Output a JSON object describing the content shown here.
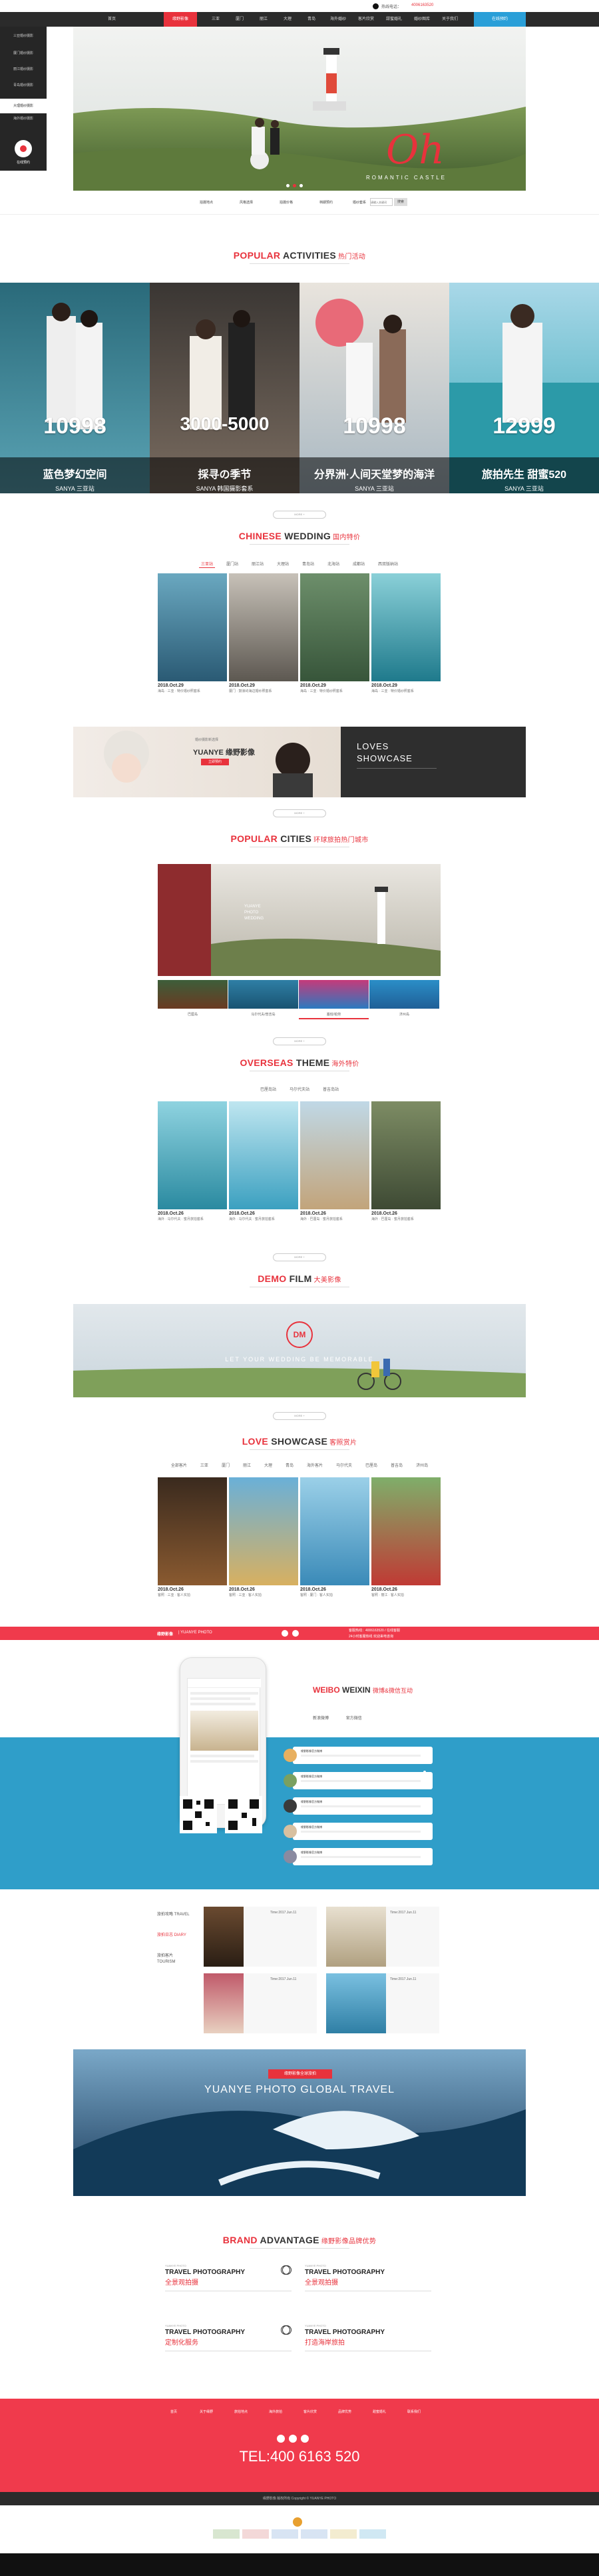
{
  "topbar": {
    "hotline_label": "热线电话：",
    "hotline": "4006163520"
  },
  "nav": {
    "items": [
      "首页",
      "缘野影像",
      "三亚",
      "厦门",
      "丽江",
      "大理",
      "青岛",
      "海外婚纱",
      "客片欣赏",
      "甜蜜婚礼",
      "婚纱图库",
      "关于我们",
      "在线预约"
    ],
    "active_index": 1
  },
  "leftnav": {
    "items": [
      "三亚婚纱摄影",
      "厦门婚纱摄影",
      "丽江婚纱摄影",
      "青岛婚纱摄影",
      "大理婚纱摄影",
      "海外婚纱摄影"
    ],
    "cta": "在线预约"
  },
  "hero": {
    "script": "Oh",
    "subtitle": "ROMANTIC CASTLE"
  },
  "searchbar": {
    "items": [
      "拍摄地点",
      "风格选择",
      "拍摄价格",
      "档期预约",
      "婚纱套系"
    ],
    "placeholder": "请输入关键词",
    "button": "搜索"
  },
  "sections": {
    "activities": {
      "en_red": "POPULAR",
      "en_dark": "ACTIVITIES",
      "cn": "热门活动"
    },
    "chinese": {
      "en_red": "CHINESE",
      "en_dark": "WEDDING",
      "cn": "国内特价"
    },
    "cities": {
      "en_red": "POPULAR",
      "en_dark": "CITIES",
      "cn": "环球旅拍热门城市"
    },
    "overseas": {
      "en_red": "OVERSEAS",
      "en_dark": "THEME",
      "cn": "海外特价"
    },
    "demo": {
      "en_red": "DEMO",
      "en_dark": "FILM",
      "cn": "大美影像"
    },
    "loves": {
      "en_red": "LOVE",
      "en_dark": "SHOWCASE",
      "cn": "客照赏片"
    },
    "weibo": {
      "en_red": "WEIBO",
      "en_dark": "WEIXIN",
      "cn": "微博&微信互动"
    },
    "brand": {
      "en_red": "BRAND",
      "en_dark": "ADVANTAGE",
      "cn": "缘野影像品牌优势"
    }
  },
  "more_pill": "MORE +",
  "activities": [
    {
      "price": "10998",
      "name": "蓝色梦幻空间",
      "place": "SANYA 三亚站"
    },
    {
      "price": "3000-5000",
      "name": "採寻の季节",
      "place": "SANYA 韩国摄影套系"
    },
    {
      "price": "10998",
      "name": "分界洲·人间天堂梦的海洋",
      "place": "SANYA 三亚站"
    },
    {
      "price": "12999",
      "name": "旅拍先生 甜蜜520",
      "place": "SANYA 三亚站"
    }
  ],
  "chinese_tabs": [
    "三亚站",
    "厦门站",
    "丽江站",
    "大理站",
    "青岛站",
    "北海站",
    "成都站",
    "西双版纳站"
  ],
  "chinese_cards": [
    {
      "date": "2018.Oct.29",
      "desc": "海岛 · 三亚 · 特价婚纱照套系"
    },
    {
      "date": "2018.Oct.29",
      "desc": "厦门 · 鼓浪屿海边婚纱照套系"
    },
    {
      "date": "2018.Oct.29",
      "desc": "海岛 · 三亚 · 特价婚纱照套系"
    },
    {
      "date": "2018.Oct.29",
      "desc": "海岛 · 三亚 · 特价婚纱照套系"
    }
  ],
  "banner": {
    "brand_cn": "缘野影像",
    "brand_en": "YUANYE",
    "top": "婚纱摄影新选择",
    "btn": "立即预约",
    "loves": "LOVES",
    "showcase": "SHOWCASE"
  },
  "cities": {
    "hero_lines": [
      "YUANYE",
      "PHOTO",
      "WEDDING"
    ],
    "labels": [
      "巴厘岛",
      "马尔代夫/普吉岛",
      "塞班/帕劳",
      "济州岛"
    ]
  },
  "overseas_tabs": [
    "巴厘岛站",
    "马尔代夫站",
    "普吉岛站"
  ],
  "overseas_cards": [
    {
      "date": "2018.Oct.26",
      "desc": "海外 · 马尔代夫 · 蜜月旅拍套系"
    },
    {
      "date": "2018.Oct.26",
      "desc": "海外 · 马尔代夫 · 蜜月旅拍套系"
    },
    {
      "date": "2018.Oct.26",
      "desc": "海外 · 巴厘岛 · 蜜月旅拍套系"
    },
    {
      "date": "2018.Oct.26",
      "desc": "海外 · 巴厘岛 · 蜜月旅拍套系"
    }
  ],
  "demo": {
    "logo": "DM",
    "text": "LET YOUR WEDDING BE MEMORABLE"
  },
  "loves_tabs": [
    "全部客片",
    "三亚",
    "厦门",
    "丽江",
    "大理",
    "青岛",
    "海外客片",
    "马尔代夫",
    "巴厘岛",
    "普吉岛",
    "济州岛"
  ],
  "loves_cards": [
    {
      "date": "2018.Oct.26",
      "desc": "客照 · 三亚 · 客人实拍"
    },
    {
      "date": "2018.Oct.26",
      "desc": "客照 · 三亚 · 客人实拍"
    },
    {
      "date": "2018.Oct.26",
      "desc": "客照 · 厦门 · 客人实拍"
    },
    {
      "date": "2018.Oct.26",
      "desc": "客照 · 丽江 · 客人实拍"
    }
  ],
  "redstrip": {
    "left": "缘野影像",
    "left2": "| YUANYE PHOTO",
    "right1": "客服热线：4006163520 / 在线客服",
    "right2": "24小时客服热线 欢迎来电咨询"
  },
  "weibo": {
    "tabs": [
      "新浪微博",
      "官方微信"
    ],
    "posts": [
      "缘野影像官方微博",
      "缘野影像官方微博",
      "缘野影像官方微博",
      "缘野影像官方微博",
      "缘野影像官方微博"
    ]
  },
  "travel": {
    "side": [
      "旅拍攻略 TRAVEL",
      "旅拍日志 DIARY",
      "旅拍客片 TOURISM"
    ],
    "dates": [
      "Time:2017.Jun.11",
      "Time:2017.Jun.11",
      "Time:2017.Jun.11",
      "Time:2017.Jun.11"
    ]
  },
  "global": {
    "tag": "缘野影像全球旅拍",
    "title": "YUANYE PHOTO GLOBAL TRAVEL"
  },
  "advantages": [
    {
      "en": "YUANYE PHOTO",
      "h": "TRAVEL PHOTOGRAPHY",
      "c": "全景观拍摄"
    },
    {
      "en": "YUANYE PHOTO",
      "h": "TRAVEL PHOTOGRAPHY",
      "c": "全景观拍摄"
    },
    {
      "en": "YUANYE PHOTO",
      "h": "TRAVEL PHOTOGRAPHY",
      "c": "定制化服务"
    },
    {
      "en": "YUANYE PHOTO",
      "h": "TRAVEL PHOTOGRAPHY",
      "c": "打造海岸旅拍"
    }
  ],
  "footer": {
    "links": [
      "首页",
      "关于缘野",
      "旅拍地点",
      "海外旅拍",
      "客片欣赏",
      "品牌优势",
      "甜蜜婚礼",
      "联系我们"
    ],
    "tel": "TEL:400 6163 520",
    "copy": "缘野影像 版权所有",
    "copy2": "Copyright © YUANYE PHOTO"
  },
  "colors": {
    "accent": "#e8323c",
    "blue": "#2a9fd8",
    "nav": "#2b2b2b"
  }
}
